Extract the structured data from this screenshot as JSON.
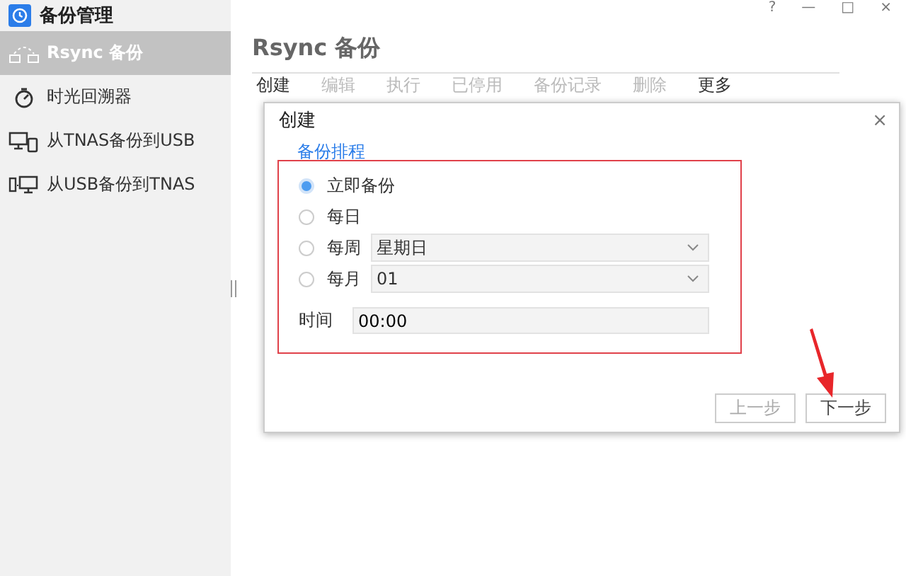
{
  "app": {
    "title": "备份管理"
  },
  "sidebar": {
    "items": [
      {
        "label": "Rsync 备份",
        "kind": "network",
        "selected": true
      },
      {
        "label": "时光回溯器",
        "kind": "timer",
        "selected": false
      },
      {
        "label": "从TNAS备份到USB",
        "kind": "nas-usb",
        "selected": false
      },
      {
        "label": "从USB备份到TNAS",
        "kind": "usb-nas",
        "selected": false
      }
    ]
  },
  "window_controls": [
    "?",
    "—",
    "□",
    "×"
  ],
  "page": {
    "title": "Rsync 备份",
    "toolbar": [
      {
        "label": "创建",
        "disabled": false
      },
      {
        "label": "编辑",
        "disabled": true
      },
      {
        "label": "执行",
        "disabled": true
      },
      {
        "label": "已停用",
        "disabled": true
      },
      {
        "label": "备份记录",
        "disabled": true
      },
      {
        "label": "删除",
        "disabled": true
      },
      {
        "label": "更多",
        "disabled": false
      }
    ]
  },
  "dialog": {
    "title": "创建",
    "close": "×",
    "section": "备份排程",
    "options": [
      {
        "label": "立即备份",
        "selected": true
      },
      {
        "label": "每日",
        "selected": false
      },
      {
        "label": "每周",
        "selected": false,
        "select_value": "星期日"
      },
      {
        "label": "每月",
        "selected": false,
        "select_value": "01"
      }
    ],
    "time": {
      "label": "时间",
      "value": "00:00"
    },
    "buttons": [
      {
        "label": "上一步",
        "disabled": true
      },
      {
        "label": "下一步",
        "disabled": false
      }
    ]
  }
}
